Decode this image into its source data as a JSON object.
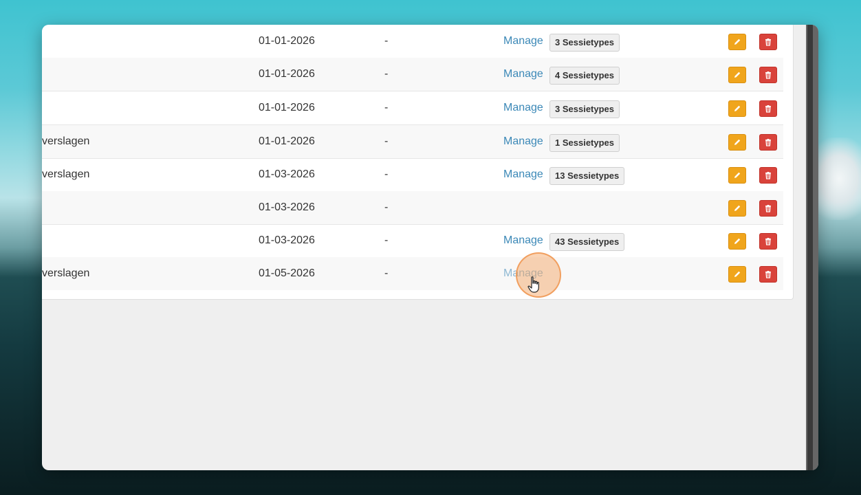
{
  "rows": [
    {
      "name": "",
      "date": "01-01-2026",
      "dash": "-",
      "manage": "Manage",
      "badge": "3 Sessietypes"
    },
    {
      "name": "",
      "date": "01-01-2026",
      "dash": "-",
      "manage": "Manage",
      "badge": "4 Sessietypes"
    },
    {
      "name": "",
      "date": "01-01-2026",
      "dash": "-",
      "manage": "Manage",
      "badge": "3 Sessietypes"
    },
    {
      "name": "verslagen",
      "date": "01-01-2026",
      "dash": "-",
      "manage": "Manage",
      "badge": "1 Sessietypes"
    },
    {
      "name": "verslagen",
      "date": "01-03-2026",
      "dash": "-",
      "manage": "Manage",
      "badge": "13 Sessietypes"
    },
    {
      "name": "",
      "date": "01-03-2026",
      "dash": "-",
      "manage": "",
      "badge": ""
    },
    {
      "name": "",
      "date": "01-03-2026",
      "dash": "-",
      "manage": "Manage",
      "badge": "43 Sessietypes"
    },
    {
      "name": "verslagen",
      "date": "01-05-2026",
      "dash": "-",
      "manage": "Manage",
      "badge": ""
    }
  ],
  "colors": {
    "link": "#3b88b7",
    "edit_button": "#f0a51c",
    "delete_button": "#d9433b"
  },
  "icons": {
    "edit": "pencil-icon",
    "delete": "trash-icon",
    "cursor": "hand-pointer-icon"
  }
}
